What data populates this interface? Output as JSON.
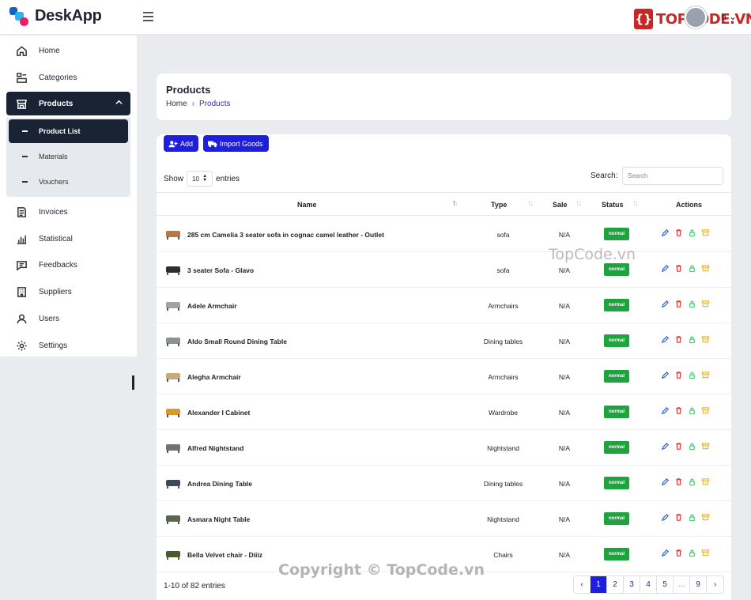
{
  "app": {
    "brand": "DeskApp",
    "watermark_logo": "TOPCODE.VN",
    "user_suffix": "n"
  },
  "sidebar": {
    "items": [
      {
        "label": "Home",
        "icon": "home-icon"
      },
      {
        "label": "Categories",
        "icon": "categories-icon"
      },
      {
        "label": "Products",
        "icon": "store-icon",
        "active": true
      },
      {
        "label": "Invoices",
        "icon": "invoice-icon"
      },
      {
        "label": "Statistical",
        "icon": "bar-chart-icon"
      },
      {
        "label": "Feedbacks",
        "icon": "message-icon"
      },
      {
        "label": "Suppliers",
        "icon": "building-icon"
      },
      {
        "label": "Users",
        "icon": "user-icon"
      },
      {
        "label": "Settings",
        "icon": "gear-icon"
      }
    ],
    "submenu": [
      {
        "label": "Product List",
        "active": true
      },
      {
        "label": "Materials"
      },
      {
        "label": "Vouchers"
      }
    ]
  },
  "page": {
    "title": "Products",
    "breadcrumb": [
      "Home",
      "Products"
    ]
  },
  "toolbar": {
    "add_label": "Add",
    "import_label": "Import Goods"
  },
  "table_controls": {
    "show_label": "Show",
    "entries_value": "10",
    "entries_label": "entries",
    "search_label": "Search:",
    "search_placeholder": "Search"
  },
  "columns": [
    "Name",
    "Type",
    "Sale",
    "Status",
    "Actions"
  ],
  "rows": [
    {
      "name": "285 cm Camelia 3 seater sofa in cognac camel leather - Outlet",
      "type": "sofa",
      "sale": "N/A",
      "status": "normal",
      "thumb_color": "#b07a4a"
    },
    {
      "name": "3 seater Sofa - Glavo",
      "type": "sofa",
      "sale": "N/A",
      "status": "normal",
      "thumb_color": "#2e2e2e"
    },
    {
      "name": "Adele Armchair",
      "type": "Armchairs",
      "sale": "N/A",
      "status": "normal",
      "thumb_color": "#9ea3a8"
    },
    {
      "name": "Aldo Small Round Dining Table",
      "type": "Dining tables",
      "sale": "N/A",
      "status": "normal",
      "thumb_color": "#8e9196"
    },
    {
      "name": "Alegha Armchair",
      "type": "Armchairs",
      "sale": "N/A",
      "status": "normal",
      "thumb_color": "#c9a97a"
    },
    {
      "name": "Alexander I Cabinet",
      "type": "Wardrobe",
      "sale": "N/A",
      "status": "normal",
      "thumb_color": "#d89b2a"
    },
    {
      "name": "Alfred Nightstand",
      "type": "Nightstand",
      "sale": "N/A",
      "status": "normal",
      "thumb_color": "#6f7378"
    },
    {
      "name": "Andrea Dining Table",
      "type": "Dining tables",
      "sale": "N/A",
      "status": "normal",
      "thumb_color": "#3b4a5a"
    },
    {
      "name": "Asmara Night Table",
      "type": "Nightstand",
      "sale": "N/A",
      "status": "normal",
      "thumb_color": "#5a6650"
    },
    {
      "name": "Bella Velvet chair - Diiiz",
      "type": "Chairs",
      "sale": "N/A",
      "status": "normal",
      "thumb_color": "#4b5a2a"
    }
  ],
  "footer": {
    "info": "1-10 of 82 entries",
    "pages": [
      "1",
      "2",
      "3",
      "4",
      "5",
      "...",
      "9"
    ],
    "current_page": "1"
  },
  "watermarks": {
    "middle": "TopCode.vn",
    "bottom": "Copyright © TopCode.vn"
  },
  "colors": {
    "primary": "#1d1fdc",
    "sidebar_active": "#1a2333",
    "status_green": "#1fa33f",
    "edit": "#2c5fd6",
    "delete": "#e53935",
    "lock": "#3ec46d",
    "archive": "#e6b422"
  }
}
